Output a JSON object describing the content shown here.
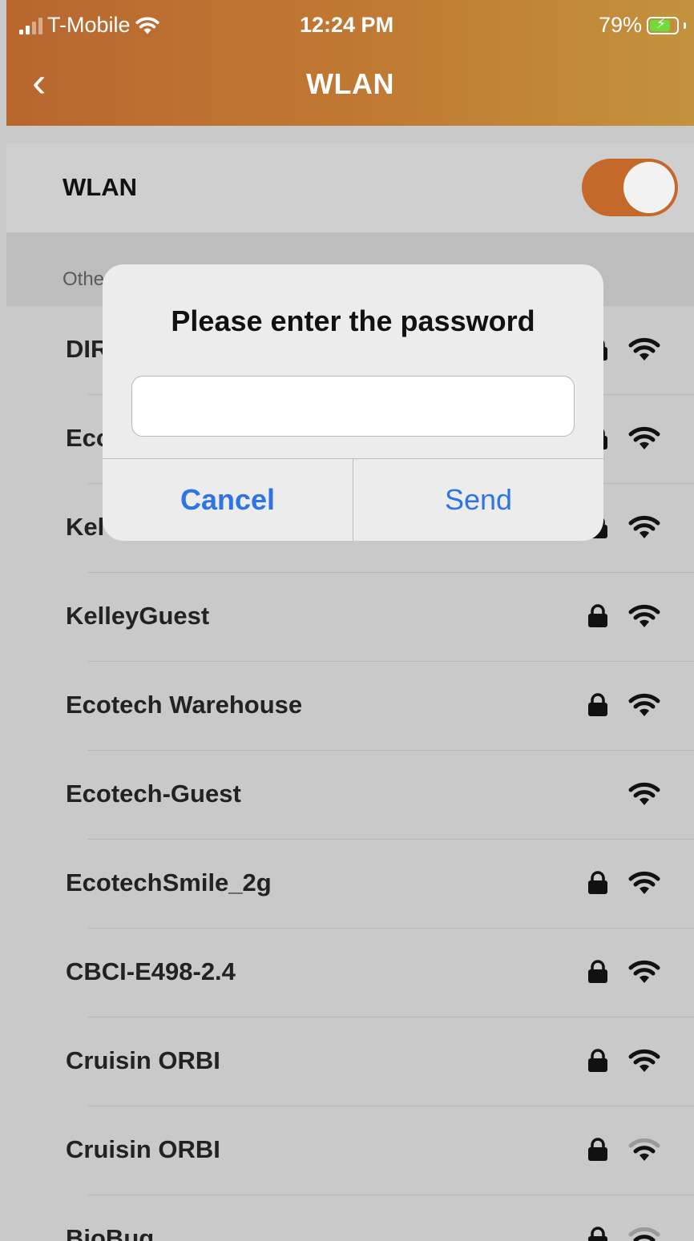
{
  "status_bar": {
    "carrier": "T-Mobile",
    "time": "12:24 PM",
    "battery": "79%"
  },
  "nav": {
    "back_glyph": "‹",
    "title": "WLAN"
  },
  "wlan_toggle": {
    "label": "WLAN",
    "on": true
  },
  "section": {
    "label": "Othe"
  },
  "networks": [
    {
      "name": "DIR",
      "locked": true,
      "signal": "strong"
    },
    {
      "name": "Eco",
      "locked": true,
      "signal": "strong"
    },
    {
      "name": "Kel",
      "locked": true,
      "signal": "strong"
    },
    {
      "name": "KelleyGuest",
      "locked": true,
      "signal": "strong"
    },
    {
      "name": "Ecotech Warehouse",
      "locked": true,
      "signal": "strong"
    },
    {
      "name": "Ecotech-Guest",
      "locked": false,
      "signal": "strong"
    },
    {
      "name": "EcotechSmile_2g",
      "locked": true,
      "signal": "strong"
    },
    {
      "name": "CBCI-E498-2.4",
      "locked": true,
      "signal": "strong"
    },
    {
      "name": "Cruisin ORBI",
      "locked": true,
      "signal": "strong"
    },
    {
      "name": "Cruisin ORBI",
      "locked": true,
      "signal": "weak"
    },
    {
      "name": "BioBug",
      "locked": true,
      "signal": "weak"
    }
  ],
  "dialog": {
    "title": "Please enter the password",
    "input_value": "",
    "cancel_label": "Cancel",
    "send_label": "Send"
  },
  "colors": {
    "header_start": "#b8672f",
    "header_end": "#c2923c",
    "toggle_on": "#c4692a",
    "dialog_button": "#2f74e6"
  }
}
